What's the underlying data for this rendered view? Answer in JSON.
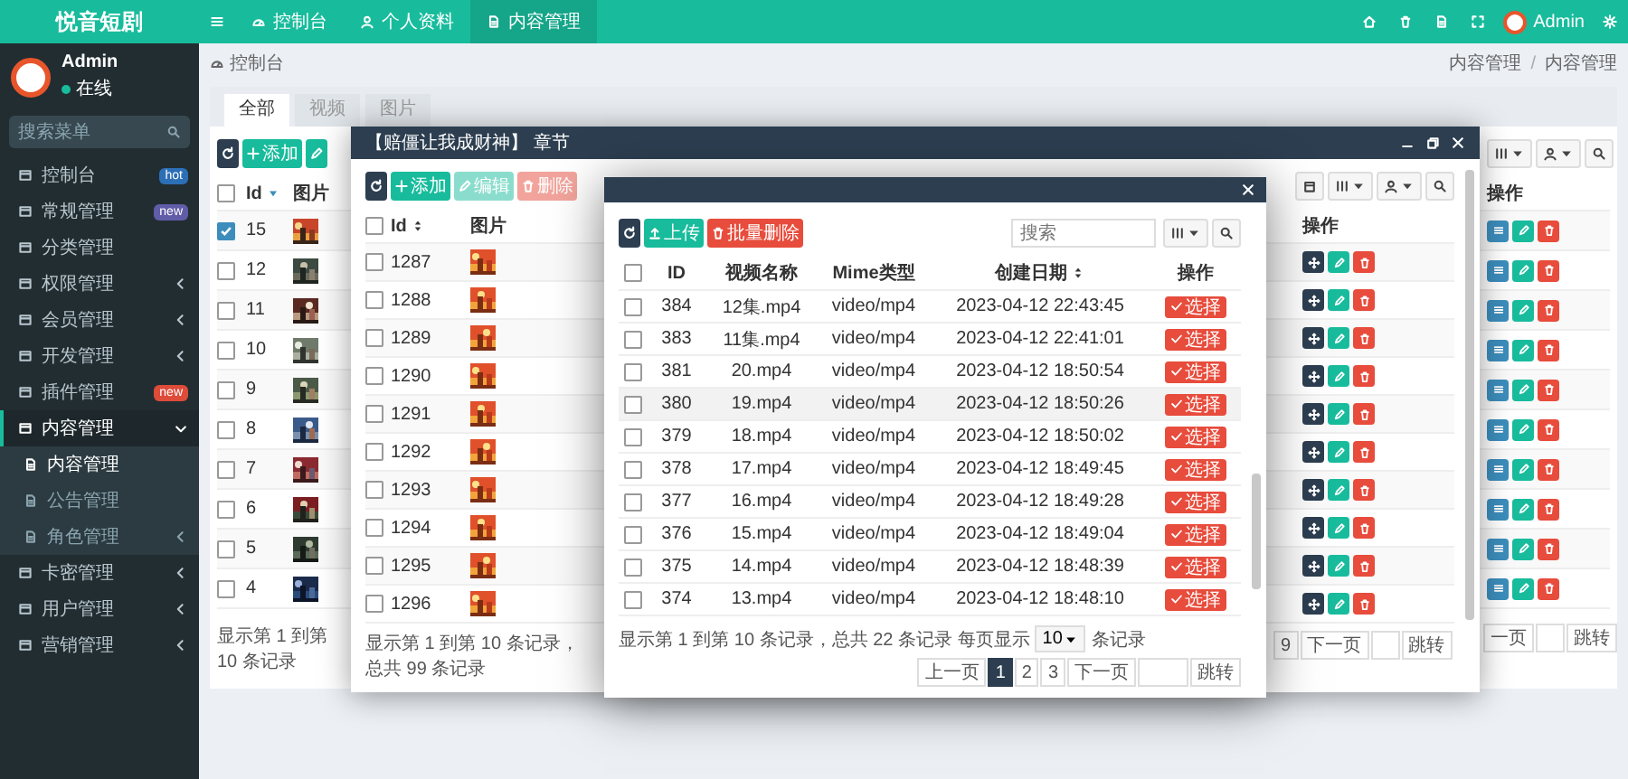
{
  "sidebar": {
    "logo": "悦音短剧",
    "user": {
      "name": "Admin",
      "status": "在线",
      "online": true
    },
    "search": {
      "placeholder": "搜索菜单"
    },
    "items": [
      {
        "label": "控制台",
        "selected": false,
        "badge": {
          "text": "hot",
          "color": "#2c6fb7"
        }
      },
      {
        "label": "常规管理",
        "selected": false,
        "badge": {
          "text": "new",
          "color": "#605ca8"
        }
      },
      {
        "label": "分类管理",
        "selected": false
      },
      {
        "label": "权限管理",
        "selected": false,
        "expanded": false
      },
      {
        "label": "会员管理",
        "selected": false,
        "expanded": false
      },
      {
        "label": "开发管理",
        "selected": false,
        "expanded": false
      },
      {
        "label": "插件管理",
        "selected": false,
        "badge": {
          "text": "new",
          "color": "#dd4b39"
        }
      },
      {
        "label": "内容管理",
        "selected": true,
        "expanded": true,
        "children": [
          {
            "label": "内容管理",
            "selected": true
          },
          {
            "label": "公告管理",
            "selected": false
          },
          {
            "label": "角色管理",
            "selected": false,
            "expanded": false
          }
        ]
      },
      {
        "label": "卡密管理",
        "selected": false,
        "expanded": false
      },
      {
        "label": "用户管理",
        "selected": false,
        "expanded": false
      },
      {
        "label": "营销管理",
        "selected": false,
        "expanded": false
      }
    ]
  },
  "topbar": {
    "tabs": [
      {
        "label": "控制台",
        "selected": false
      },
      {
        "label": "个人资料",
        "selected": false
      },
      {
        "label": "内容管理",
        "selected": true
      }
    ],
    "user": "Admin"
  },
  "breadcrumb": {
    "title": "控制台",
    "path": [
      {
        "label": "内容管理"
      },
      {
        "label": "内容管理"
      }
    ],
    "separator": "/"
  },
  "panel": {
    "tabs": [
      {
        "label": "全部",
        "selected": true
      },
      {
        "label": "视频",
        "selected": false
      },
      {
        "label": "图片",
        "selected": false
      }
    ],
    "toolbar": [
      {
        "kind": "refresh",
        "disabled": false
      },
      {
        "kind": "add",
        "label": "添加",
        "disabled": false
      },
      {
        "kind": "edit",
        "disabled": false
      }
    ],
    "tools": [
      {
        "kind": "columns"
      },
      {
        "kind": "export"
      },
      {
        "kind": "search"
      }
    ],
    "table": {
      "header_checked": false,
      "columns": [
        {
          "label": "Id",
          "sorted": true
        },
        {
          "label": "图片"
        }
      ],
      "actions_header": "操作",
      "row_actions": [
        {
          "kind": "detail"
        },
        {
          "kind": "edit"
        },
        {
          "kind": "delete"
        }
      ],
      "rows": [
        {
          "id": "15",
          "checked": true
        },
        {
          "id": "12",
          "checked": false
        },
        {
          "id": "11",
          "checked": false
        },
        {
          "id": "10",
          "checked": false
        },
        {
          "id": "9",
          "checked": false
        },
        {
          "id": "8",
          "checked": false
        },
        {
          "id": "7",
          "checked": false
        },
        {
          "id": "6",
          "checked": false
        },
        {
          "id": "5",
          "checked": false
        },
        {
          "id": "4",
          "checked": false
        }
      ]
    },
    "footer": "显示第 1 到第 10 条记录",
    "pager": [
      {
        "label": "一页",
        "selected": false
      }
    ],
    "jump": "跳转"
  },
  "chapter_dialog": {
    "title": "【赔僵让我成财神】 章节",
    "toolbar": [
      {
        "kind": "refresh",
        "disabled": false
      },
      {
        "kind": "add",
        "label": "添加",
        "disabled": false
      },
      {
        "kind": "edit",
        "label": "编辑",
        "disabled": true
      },
      {
        "kind": "delete",
        "label": "删除",
        "disabled": true
      }
    ],
    "tools": [
      {
        "kind": "calendar"
      },
      {
        "kind": "columns"
      },
      {
        "kind": "export"
      },
      {
        "kind": "search"
      }
    ],
    "table": {
      "header_checked": false,
      "columns": [
        {
          "label": "Id",
          "sorted": false
        },
        {
          "label": "图片"
        }
      ],
      "actions_header": "操作",
      "row_actions": [
        {
          "kind": "move"
        },
        {
          "kind": "edit"
        },
        {
          "kind": "delete"
        }
      ],
      "rows": [
        {
          "id": "1287",
          "checked": false
        },
        {
          "id": "1288",
          "checked": false
        },
        {
          "id": "1289",
          "checked": false
        },
        {
          "id": "1290",
          "checked": false
        },
        {
          "id": "1291",
          "checked": false
        },
        {
          "id": "1292",
          "checked": false
        },
        {
          "id": "1293",
          "checked": false
        },
        {
          "id": "1294",
          "checked": false
        },
        {
          "id": "1295",
          "checked": false
        },
        {
          "id": "1296",
          "checked": false
        }
      ]
    },
    "footer": "显示第 1 到第 10 条记录，总共 99 条记录",
    "pager": [
      {
        "label": "9",
        "selected": false
      },
      {
        "label": "下一页",
        "selected": false
      }
    ],
    "jump": "跳转"
  },
  "video_dialog": {
    "toolbar": [
      {
        "kind": "refresh",
        "disabled": false
      },
      {
        "kind": "upload",
        "label": "上传",
        "disabled": false
      },
      {
        "kind": "delete",
        "label": "批量删除",
        "disabled": false
      }
    ],
    "search": {
      "placeholder": "搜索"
    },
    "tools": [
      {
        "kind": "columns"
      },
      {
        "kind": "search"
      }
    ],
    "table": {
      "header_checked": false,
      "columns": [
        {
          "label": "ID"
        },
        {
          "label": "视频名称"
        },
        {
          "label": "Mime类型"
        },
        {
          "label": "创建日期",
          "sorted": false
        },
        {
          "label": "操作"
        }
      ],
      "rows": [
        {
          "id": "384",
          "name": "12集.mp4",
          "mime": "video/mp4",
          "created": "2023-04-12 22:43:45",
          "action": "选择",
          "checked": false,
          "highlighted": false
        },
        {
          "id": "383",
          "name": "11集.mp4",
          "mime": "video/mp4",
          "created": "2023-04-12 22:41:01",
          "action": "选择",
          "checked": false,
          "highlighted": false
        },
        {
          "id": "381",
          "name": "20.mp4",
          "mime": "video/mp4",
          "created": "2023-04-12 18:50:54",
          "action": "选择",
          "checked": false,
          "highlighted": false
        },
        {
          "id": "380",
          "name": "19.mp4",
          "mime": "video/mp4",
          "created": "2023-04-12 18:50:26",
          "action": "选择",
          "checked": false,
          "highlighted": true
        },
        {
          "id": "379",
          "name": "18.mp4",
          "mime": "video/mp4",
          "created": "2023-04-12 18:50:02",
          "action": "选择",
          "checked": false,
          "highlighted": false
        },
        {
          "id": "378",
          "name": "17.mp4",
          "mime": "video/mp4",
          "created": "2023-04-12 18:49:45",
          "action": "选择",
          "checked": false,
          "highlighted": false
        },
        {
          "id": "377",
          "name": "16.mp4",
          "mime": "video/mp4",
          "created": "2023-04-12 18:49:28",
          "action": "选择",
          "checked": false,
          "highlighted": false
        },
        {
          "id": "376",
          "name": "15.mp4",
          "mime": "video/mp4",
          "created": "2023-04-12 18:49:04",
          "action": "选择",
          "checked": false,
          "highlighted": false
        },
        {
          "id": "375",
          "name": "14.mp4",
          "mime": "video/mp4",
          "created": "2023-04-12 18:48:39",
          "action": "选择",
          "checked": false,
          "highlighted": false
        },
        {
          "id": "374",
          "name": "13.mp4",
          "mime": "video/mp4",
          "created": "2023-04-12 18:48:10",
          "action": "选择",
          "checked": false,
          "highlighted": false
        }
      ]
    },
    "footer": {
      "summary": "显示第 1 到第 10 条记录，总共 22 条记录 每页显示",
      "page_size": "10",
      "unit": "条记录"
    },
    "pager": [
      {
        "label": "上一页",
        "selected": false
      },
      {
        "label": "1",
        "selected": true
      },
      {
        "label": "2",
        "selected": false
      },
      {
        "label": "3",
        "selected": false
      },
      {
        "label": "下一页",
        "selected": false
      }
    ],
    "jump": "跳转"
  }
}
